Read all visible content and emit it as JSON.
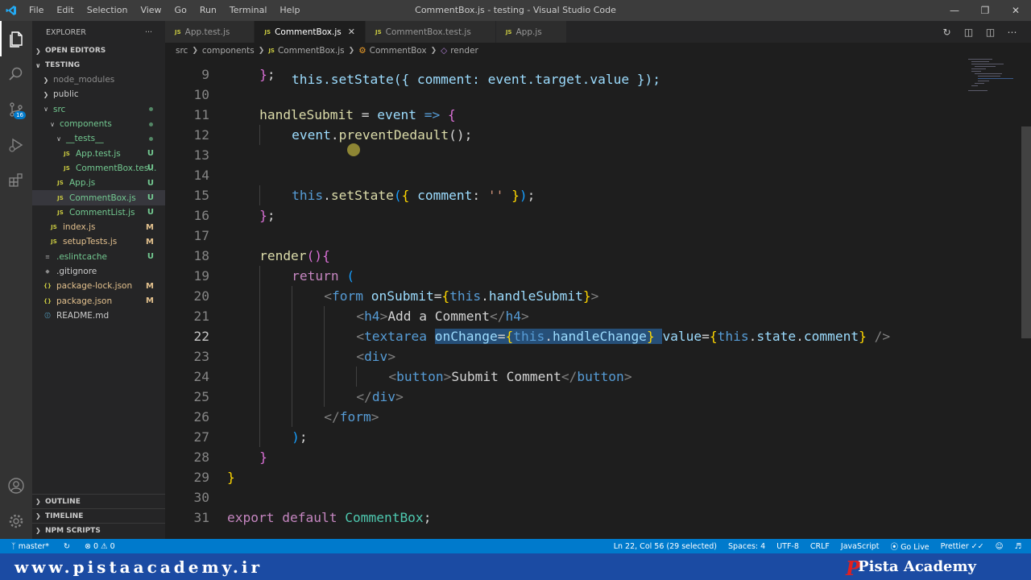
{
  "titlebar": {
    "menu": [
      "File",
      "Edit",
      "Selection",
      "View",
      "Go",
      "Run",
      "Terminal",
      "Help"
    ],
    "title": "CommentBox.js - testing - Visual Studio Code"
  },
  "activity_icons": [
    "explorer-icon",
    "search-icon",
    "source-control-icon",
    "run-debug-icon",
    "extensions-icon",
    "account-icon",
    "settings-gear-icon"
  ],
  "source_control_badge": "16",
  "sidebar": {
    "header": "EXPLORER",
    "more": "···",
    "open_editors": "OPEN EDITORS",
    "folder": "TESTING",
    "tree": [
      {
        "name": "node_modules",
        "indent": 1,
        "type": "folder",
        "open": false,
        "color": "gray",
        "status": ""
      },
      {
        "name": "public",
        "indent": 1,
        "type": "folder",
        "open": false,
        "color": "white",
        "status": ""
      },
      {
        "name": "src",
        "indent": 1,
        "type": "folder",
        "open": true,
        "color": "green",
        "status": "dot"
      },
      {
        "name": "components",
        "indent": 2,
        "type": "folder",
        "open": true,
        "color": "green",
        "status": "dot"
      },
      {
        "name": "__tests__",
        "indent": 3,
        "type": "folder",
        "open": true,
        "color": "green",
        "status": "dot"
      },
      {
        "name": "App.test.js",
        "indent": 4,
        "type": "js",
        "color": "green",
        "status": "U"
      },
      {
        "name": "CommentBox.tes...",
        "indent": 4,
        "type": "js",
        "color": "green",
        "status": "U"
      },
      {
        "name": "App.js",
        "indent": 3,
        "type": "js",
        "color": "green",
        "status": "U"
      },
      {
        "name": "CommentBox.js",
        "indent": 3,
        "type": "js",
        "color": "green",
        "status": "U",
        "selected": true
      },
      {
        "name": "CommentList.js",
        "indent": 3,
        "type": "js",
        "color": "green",
        "status": "U"
      },
      {
        "name": "index.js",
        "indent": 2,
        "type": "js",
        "color": "yellow",
        "status": "M"
      },
      {
        "name": "setupTests.js",
        "indent": 2,
        "type": "js",
        "color": "yellow",
        "status": "M"
      },
      {
        "name": ".eslintcache",
        "indent": 1,
        "type": "file",
        "color": "green",
        "status": "U"
      },
      {
        "name": ".gitignore",
        "indent": 1,
        "type": "git",
        "color": "white",
        "status": ""
      },
      {
        "name": "package-lock.json",
        "indent": 1,
        "type": "json",
        "color": "yellow",
        "status": "M"
      },
      {
        "name": "package.json",
        "indent": 1,
        "type": "json",
        "color": "yellow",
        "status": "M"
      },
      {
        "name": "README.md",
        "indent": 1,
        "type": "info",
        "color": "white",
        "status": ""
      }
    ],
    "bottom_sections": [
      "OUTLINE",
      "TIMELINE",
      "NPM SCRIPTS"
    ]
  },
  "tabs": [
    {
      "label": "App.test.js",
      "active": false
    },
    {
      "label": "CommentBox.js",
      "active": true
    },
    {
      "label": "CommentBox.test.js",
      "active": false
    },
    {
      "label": "App.js",
      "active": false
    }
  ],
  "breadcrumb": {
    "parts": [
      "src",
      "components",
      "CommentBox.js",
      "CommentBox",
      "render"
    ]
  },
  "editor": {
    "current_line": 22,
    "lines": [
      {
        "n": 9,
        "indent": 1,
        "tokens": [
          [
            "br2",
            "}"
          ],
          [
            "t",
            ";"
          ]
        ]
      },
      {
        "n": 10,
        "indent": 0,
        "tokens": []
      },
      {
        "n": 11,
        "indent": 1,
        "tokens": [
          [
            "f",
            "handleSubmit"
          ],
          [
            "t",
            " = "
          ],
          [
            "v",
            "event"
          ],
          [
            "t",
            " "
          ],
          [
            "b",
            "=>"
          ],
          [
            "t",
            " "
          ],
          [
            "br2",
            "{"
          ]
        ]
      },
      {
        "n": 12,
        "indent": 2,
        "tokens": [
          [
            "v",
            "event"
          ],
          [
            "t",
            "."
          ],
          [
            "f",
            "preventDedault"
          ],
          [
            "t",
            "();"
          ]
        ]
      },
      {
        "n": 13,
        "indent": 0,
        "tokens": []
      },
      {
        "n": 14,
        "indent": 0,
        "tokens": []
      },
      {
        "n": 15,
        "indent": 2,
        "tokens": [
          [
            "b",
            "this"
          ],
          [
            "t",
            "."
          ],
          [
            "f",
            "setState"
          ],
          [
            "br3",
            "("
          ],
          [
            "br1",
            "{"
          ],
          [
            "t",
            " "
          ],
          [
            "v",
            "comment"
          ],
          [
            "t",
            ": "
          ],
          [
            "s",
            "''"
          ],
          [
            "t",
            " "
          ],
          [
            "br1",
            "}"
          ],
          [
            "br3",
            ")"
          ],
          [
            "t",
            ";"
          ]
        ]
      },
      {
        "n": 16,
        "indent": 1,
        "tokens": [
          [
            "br2",
            "}"
          ],
          [
            "t",
            ";"
          ]
        ]
      },
      {
        "n": 17,
        "indent": 0,
        "tokens": []
      },
      {
        "n": 18,
        "indent": 1,
        "tokens": [
          [
            "f",
            "render"
          ],
          [
            "br2",
            "()"
          ],
          [
            "br2",
            "{"
          ]
        ]
      },
      {
        "n": 19,
        "indent": 2,
        "tokens": [
          [
            "k",
            "return"
          ],
          [
            "t",
            " "
          ],
          [
            "br3",
            "("
          ]
        ]
      },
      {
        "n": 20,
        "indent": 3,
        "tokens": [
          [
            "p",
            "<"
          ],
          [
            "b",
            "form"
          ],
          [
            "t",
            " "
          ],
          [
            "v",
            "onSubmit"
          ],
          [
            "t",
            "="
          ],
          [
            "br1",
            "{"
          ],
          [
            "b",
            "this"
          ],
          [
            "t",
            "."
          ],
          [
            "v",
            "handleSubmit"
          ],
          [
            "br1",
            "}"
          ],
          [
            "p",
            ">"
          ]
        ]
      },
      {
        "n": 21,
        "indent": 4,
        "tokens": [
          [
            "p",
            "<"
          ],
          [
            "b",
            "h4"
          ],
          [
            "p",
            ">"
          ],
          [
            "t",
            "Add a Comment"
          ],
          [
            "p",
            "</"
          ],
          [
            "b",
            "h4"
          ],
          [
            "p",
            ">"
          ]
        ]
      },
      {
        "n": 22,
        "indent": 4,
        "tokens": [
          [
            "p",
            "<"
          ],
          [
            "b",
            "textarea"
          ],
          [
            "t",
            " "
          ],
          [
            "v hl",
            "onChange"
          ],
          [
            "t hl",
            "="
          ],
          [
            "br1 hl",
            "{"
          ],
          [
            "b hl",
            "this"
          ],
          [
            "t hl",
            "."
          ],
          [
            "v hl",
            "handleChange"
          ],
          [
            "br1 hl",
            "}"
          ],
          [
            "t hl",
            " "
          ],
          [
            "v",
            "value"
          ],
          [
            "t",
            "="
          ],
          [
            "br1",
            "{"
          ],
          [
            "b",
            "this"
          ],
          [
            "t",
            "."
          ],
          [
            "v",
            "state"
          ],
          [
            "t",
            "."
          ],
          [
            "v",
            "comment"
          ],
          [
            "br1",
            "}"
          ],
          [
            "t",
            " "
          ],
          [
            "p",
            "/>"
          ]
        ]
      },
      {
        "n": 23,
        "indent": 4,
        "tokens": [
          [
            "p",
            "<"
          ],
          [
            "b",
            "div"
          ],
          [
            "p",
            ">"
          ]
        ]
      },
      {
        "n": 24,
        "indent": 5,
        "tokens": [
          [
            "p",
            "<"
          ],
          [
            "b",
            "button"
          ],
          [
            "p",
            ">"
          ],
          [
            "t",
            "Submit Comment"
          ],
          [
            "p",
            "</"
          ],
          [
            "b",
            "button"
          ],
          [
            "p",
            ">"
          ]
        ]
      },
      {
        "n": 25,
        "indent": 4,
        "tokens": [
          [
            "p",
            "</"
          ],
          [
            "b",
            "div"
          ],
          [
            "p",
            ">"
          ]
        ]
      },
      {
        "n": 26,
        "indent": 3,
        "tokens": [
          [
            "p",
            "</"
          ],
          [
            "b",
            "form"
          ],
          [
            "p",
            ">"
          ]
        ]
      },
      {
        "n": 27,
        "indent": 2,
        "tokens": [
          [
            "br3",
            ")"
          ],
          [
            "t",
            ";"
          ]
        ]
      },
      {
        "n": 28,
        "indent": 1,
        "tokens": [
          [
            "br2",
            "}"
          ]
        ]
      },
      {
        "n": 29,
        "indent": 0,
        "tokens": [
          [
            "br1",
            "}"
          ]
        ]
      },
      {
        "n": 30,
        "indent": 0,
        "tokens": []
      },
      {
        "n": 31,
        "indent": 0,
        "tokens": [
          [
            "k",
            "export"
          ],
          [
            "t",
            " "
          ],
          [
            "k",
            "default"
          ],
          [
            "t",
            " "
          ],
          [
            "c",
            "CommentBox"
          ],
          [
            "t",
            ";"
          ]
        ]
      }
    ]
  },
  "statusbar": {
    "branch": "master*",
    "errors": "0",
    "warnings": "0",
    "position": "Ln 22, Col 56 (29 selected)",
    "spaces": "Spaces: 4",
    "encoding": "UTF-8",
    "eol": "CRLF",
    "language": "JavaScript",
    "golive": "Go Live",
    "prettier": "Prettier"
  },
  "watermark": {
    "site": "www.pistaacademy.ir",
    "brand": "Pista Academy",
    "logo": "P"
  },
  "colors": {
    "accent": "#007acc",
    "watermark_bar": "#1b4ba3",
    "logo_red": "#e02020"
  }
}
